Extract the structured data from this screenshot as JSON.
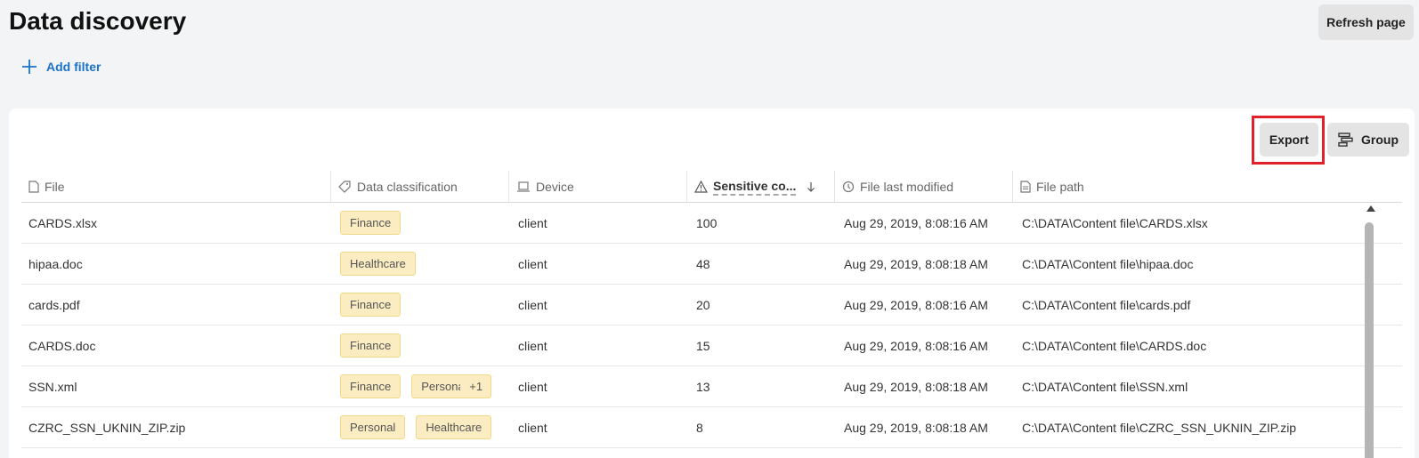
{
  "header": {
    "title": "Data discovery",
    "refresh_label": "Refresh page",
    "add_filter_label": "Add filter"
  },
  "toolbar": {
    "export_label": "Export",
    "group_label": "Group"
  },
  "table": {
    "columns": [
      {
        "label": "File",
        "icon": "file-icon"
      },
      {
        "label": "Data classification",
        "icon": "tag-icon"
      },
      {
        "label": "Device",
        "icon": "laptop-icon"
      },
      {
        "label": "Sensitive co...",
        "icon": "warning-icon",
        "sorted": "desc"
      },
      {
        "label": "File last modified",
        "icon": "history-icon"
      },
      {
        "label": "File path",
        "icon": "document-icon"
      }
    ],
    "rows": [
      {
        "file": "CARDS.xlsx",
        "tags": [
          "Finance"
        ],
        "more": "",
        "device": "client",
        "sensitive": "100",
        "modified": "Aug 29, 2019, 8:08:16 AM",
        "path": "C:\\DATA\\Content file\\CARDS.xlsx"
      },
      {
        "file": "hipaa.doc",
        "tags": [
          "Healthcare"
        ],
        "more": "",
        "device": "client",
        "sensitive": "48",
        "modified": "Aug 29, 2019, 8:08:18 AM",
        "path": "C:\\DATA\\Content file\\hipaa.doc"
      },
      {
        "file": "cards.pdf",
        "tags": [
          "Finance"
        ],
        "more": "",
        "device": "client",
        "sensitive": "20",
        "modified": "Aug 29, 2019, 8:08:16 AM",
        "path": "C:\\DATA\\Content file\\cards.pdf"
      },
      {
        "file": "CARDS.doc",
        "tags": [
          "Finance"
        ],
        "more": "",
        "device": "client",
        "sensitive": "15",
        "modified": "Aug 29, 2019, 8:08:16 AM",
        "path": "C:\\DATA\\Content file\\CARDS.doc"
      },
      {
        "file": "SSN.xml",
        "tags": [
          "Finance"
        ],
        "more_tag": "Personal",
        "more": "+1",
        "device": "client",
        "sensitive": "13",
        "modified": "Aug 29, 2019, 8:08:18 AM",
        "path": "C:\\DATA\\Content file\\SSN.xml"
      },
      {
        "file": "CZRC_SSN_UKNIN_ZIP.zip",
        "tags": [
          "Personal",
          "Healthcare"
        ],
        "more": "",
        "device": "client",
        "sensitive": "8",
        "modified": "Aug 29, 2019, 8:08:18 AM",
        "path": "C:\\DATA\\Content file\\CZRC_SSN_UKNIN_ZIP.zip"
      }
    ]
  },
  "colors": {
    "accent": "#1a73c8",
    "tag_bg": "#fbecc1",
    "highlight": "#e0202a"
  }
}
